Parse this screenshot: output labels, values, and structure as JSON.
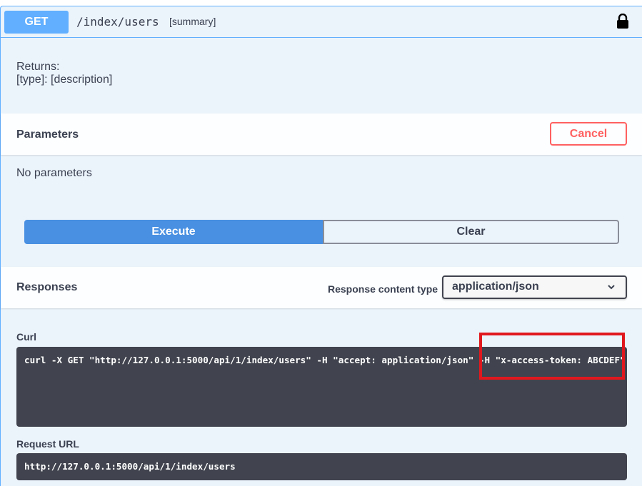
{
  "operation": {
    "method": "GET",
    "path": "/index/users",
    "summary": "[summary]",
    "lock_icon": "lock-icon"
  },
  "description": {
    "line1": "Returns:",
    "line2": "[type]: [description]"
  },
  "parameters": {
    "title": "Parameters",
    "cancel_label": "Cancel",
    "empty_text": "No parameters"
  },
  "actions": {
    "execute_label": "Execute",
    "clear_label": "Clear"
  },
  "responses": {
    "title": "Responses",
    "content_type_label": "Response content type",
    "content_type_value": "application/json",
    "chevron_icon": "chevron-down-icon"
  },
  "curl": {
    "label": "Curl",
    "command": "curl -X GET \"http://127.0.0.1:5000/api/1/index/users\" -H \"accept: application/json\" -H \"x-access-token: ABCDEF\""
  },
  "request_url": {
    "label": "Request URL",
    "value": "http://127.0.0.1:5000/api/1/index/users"
  },
  "colors": {
    "get_accent": "#61affe",
    "execute": "#4990e2",
    "cancel": "#ff6060",
    "code_bg": "#41444e",
    "highlight": "#e0181e"
  }
}
